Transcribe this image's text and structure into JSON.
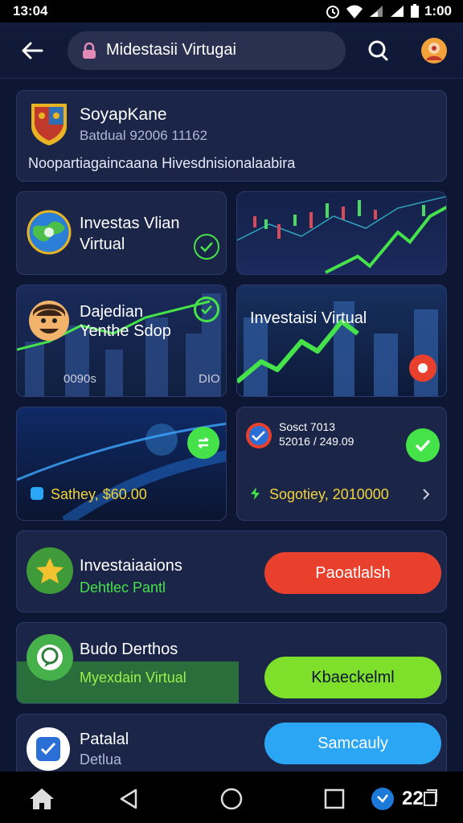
{
  "status_bar": {
    "time": "13:04",
    "clock": "1:00"
  },
  "app_bar": {
    "search_text": "Midestasii Virtugai"
  },
  "profile_card": {
    "name": "SoyapKane",
    "meta": "Batdual 92006 11162",
    "description": "Noopartiagaincaana Hivesdnisionalaabira"
  },
  "tiles": {
    "invest_virtual": {
      "line1": "Investas Vlian",
      "line2": "Virtual"
    },
    "daily_user": {
      "line1": "Dajedian",
      "line2": "Yenthe Sdop",
      "stat_a": "0090s",
      "stat_b": "DIO"
    },
    "investasi_chart": {
      "label": "Investaisi Virtual"
    },
    "balance": {
      "amount": "Sathey, $60.00"
    },
    "stats": {
      "line1": "Sosct 7013",
      "line2": "52016 / 249.09",
      "value": "Sogotiey, 2010000"
    }
  },
  "rows": [
    {
      "title": "Investaiaaions",
      "subtitle": "Dehtlec Pantl",
      "button": "Paoatlalsh",
      "button_color": "#e8402c"
    },
    {
      "title": "Budo Derthos",
      "subtitle": "Myexdain Virtual",
      "button": "Kbaeckelml",
      "button_color": "#7ee02a"
    },
    {
      "title": "Patalal",
      "subtitle": "Detlua",
      "button": "Samcauly",
      "button_color": "#2aa6f5"
    }
  ],
  "nav_bar": {
    "count": "22"
  },
  "colors": {
    "background": "#0d1633",
    "card": "#1a2548",
    "accent_green": "#46e24a",
    "accent_red": "#e8402c",
    "accent_blue": "#2aa6f5"
  }
}
